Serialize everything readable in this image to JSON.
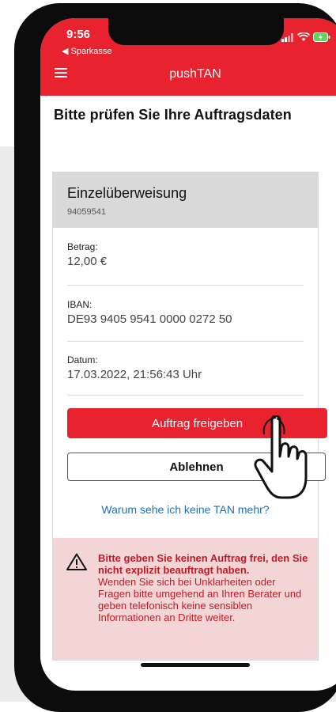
{
  "status_bar": {
    "time": "9:56",
    "back_app": "◀ Sparkasse"
  },
  "header": {
    "title": "pushTAN"
  },
  "page": {
    "heading": "Bitte prüfen Sie Ihre Auftragsdaten"
  },
  "order": {
    "type": "Einzelüberweisung",
    "number": "94059541",
    "fields": [
      {
        "label": "Betrag:",
        "value": "12,00 €"
      },
      {
        "label": "IBAN:",
        "value": "DE93 9405 9541 0000 0272 50"
      },
      {
        "label": "Datum:",
        "value": "17.03.2022, 21:56:43 Uhr"
      }
    ]
  },
  "actions": {
    "approve": "Auftrag freigeben",
    "reject": "Ablehnen",
    "help_link": "Warum sehe ich keine TAN mehr?"
  },
  "warning": {
    "bold_text": "Bitte geben Sie keinen Auftrag frei, den Sie nicht explizit beauftragt haben.",
    "text": "Wenden Sie sich bei Unklarheiten oder Fragen bitte umgehend an Ihren Berater und geben telefonisch keine sensiblen Informationen an Dritte weiter."
  },
  "colors": {
    "brand": "#e8232f",
    "link": "#1f6fb5",
    "warning_bg": "#f4d5d5",
    "warning_text": "#c21a25"
  },
  "icons": {
    "menu": "hamburger-menu-icon",
    "warning": "warning-triangle-icon",
    "pointer": "pointing-hand-icon"
  }
}
